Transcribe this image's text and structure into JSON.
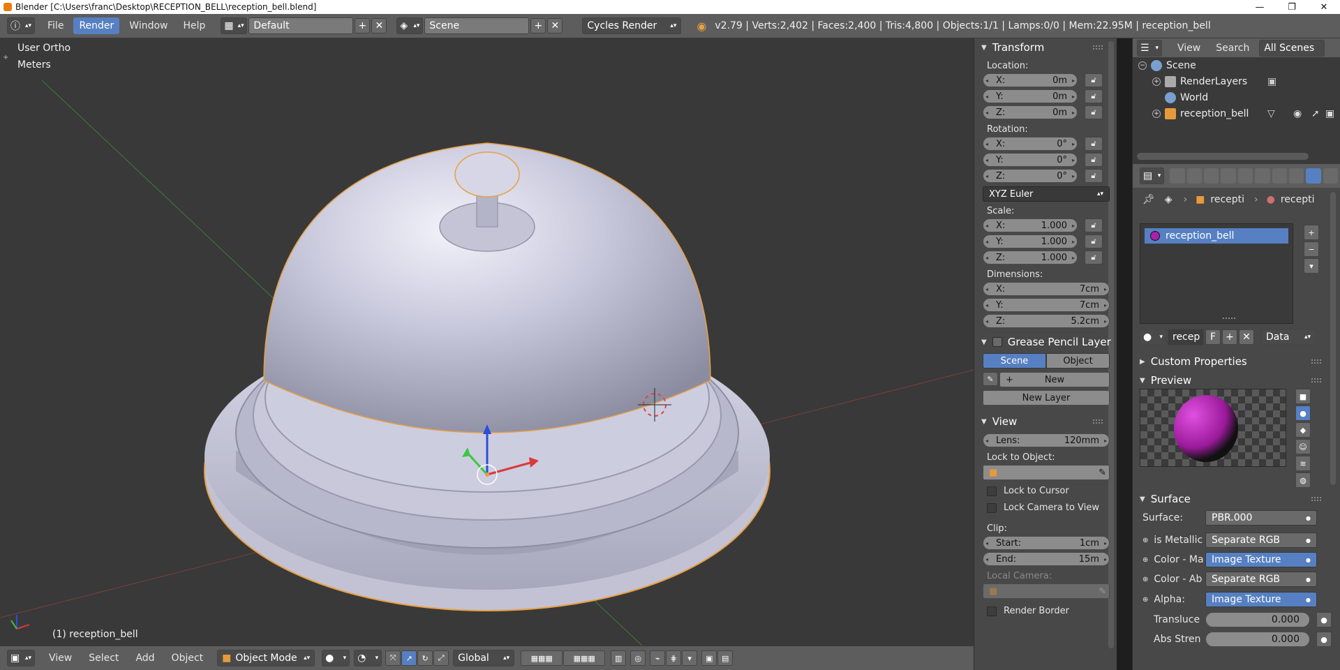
{
  "window": {
    "title": "Blender [C:\\Users\\franc\\Desktop\\RECEPTION_BELL\\reception_bell.blend]",
    "controls": [
      "—",
      "❐",
      "✕"
    ]
  },
  "info_header": {
    "menus": [
      "File",
      "Render",
      "Window",
      "Help"
    ],
    "active_menu": "Render",
    "layout": "Default",
    "scene": "Scene",
    "engine": "Cycles Render",
    "stats": "v2.79 | Verts:2,402 | Faces:2,400 | Tris:4,800 | Objects:1/1 | Lamps:0/0 | Mem:22.95M | reception_bell"
  },
  "viewport": {
    "view_name": "User Ortho",
    "units": "Meters",
    "object_label": "(1) reception_bell",
    "colors": {
      "background": "#393939",
      "bell": "#c6c6d8",
      "outline": "#e8a040"
    }
  },
  "viewport_header": {
    "menus": [
      "View",
      "Select",
      "Add",
      "Object"
    ],
    "mode": "Object Mode",
    "orientation": "Global"
  },
  "npanel": {
    "transform": {
      "title": "Transform",
      "location_label": "Location:",
      "location": [
        {
          "axis": "X:",
          "value": "0m"
        },
        {
          "axis": "Y:",
          "value": "0m"
        },
        {
          "axis": "Z:",
          "value": "0m"
        }
      ],
      "rotation_label": "Rotation:",
      "rotation": [
        {
          "axis": "X:",
          "value": "0°"
        },
        {
          "axis": "Y:",
          "value": "0°"
        },
        {
          "axis": "Z:",
          "value": "0°"
        }
      ],
      "rotation_mode": "XYZ Euler",
      "scale_label": "Scale:",
      "scale": [
        {
          "axis": "X:",
          "value": "1.000"
        },
        {
          "axis": "Y:",
          "value": "1.000"
        },
        {
          "axis": "Z:",
          "value": "1.000"
        }
      ],
      "dimensions_label": "Dimensions:",
      "dimensions": [
        {
          "axis": "X:",
          "value": "7cm"
        },
        {
          "axis": "Y:",
          "value": "7cm"
        },
        {
          "axis": "Z:",
          "value": "5.2cm"
        }
      ]
    },
    "grease": {
      "title": "Grease Pencil Layer",
      "scene_tab": "Scene",
      "object_tab": "Object",
      "new_label": "New",
      "new_layer_label": "New Layer"
    },
    "view": {
      "title": "View",
      "lens_label": "Lens:",
      "lens_value": "120mm",
      "lock_object_label": "Lock to Object:",
      "lock_cursor": "Lock to Cursor",
      "lock_camera": "Lock Camera to View",
      "clip_label": "Clip:",
      "clip_start_label": "Start:",
      "clip_start": "1cm",
      "clip_end_label": "End:",
      "clip_end": "15m",
      "local_camera_label": "Local Camera:",
      "render_border": "Render Border"
    }
  },
  "outliner": {
    "menus": [
      "View",
      "Search"
    ],
    "filter": "All Scenes",
    "items": [
      {
        "label": "Scene",
        "color": "#7aa0d0"
      },
      {
        "label": "RenderLayers",
        "color": "#aaaaaa"
      },
      {
        "label": "World",
        "color": "#7aa0d0"
      },
      {
        "label": "reception_bell",
        "color": "#e89a3a"
      }
    ]
  },
  "properties": {
    "breadcrumb": [
      "recepti",
      "recepti"
    ],
    "material_slot": "reception_bell",
    "material_name": "recep",
    "fake_user": "F",
    "link": "Data",
    "custom_properties": "Custom Properties",
    "preview": "Preview",
    "surface_panel": "Surface",
    "surface_label": "Surface:",
    "surface_value": "PBR.000",
    "inputs": [
      {
        "label": "is Metallic",
        "value": "Separate RGB",
        "highlight": false
      },
      {
        "label": "Color - Ma",
        "value": "Image Texture",
        "highlight": true
      },
      {
        "label": "Color - Ab",
        "value": "Separate RGB",
        "highlight": false
      },
      {
        "label": "Alpha:",
        "value": "Image Texture",
        "highlight": true
      }
    ],
    "sliders": [
      {
        "label": "Transluce",
        "value": "0.000"
      },
      {
        "label": "Abs Stren",
        "value": "0.000"
      }
    ]
  }
}
